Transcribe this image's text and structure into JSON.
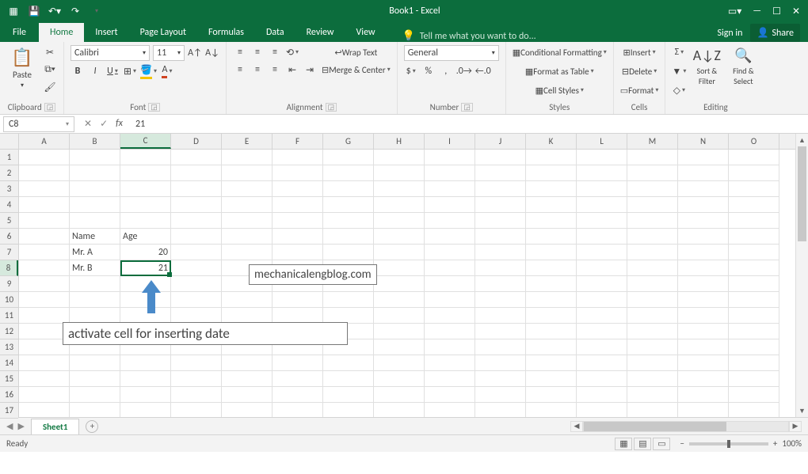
{
  "titlebar": {
    "title": "Book1 - Excel"
  },
  "tabs": {
    "file": "File",
    "list": [
      "Home",
      "Insert",
      "Page Layout",
      "Formulas",
      "Data",
      "Review",
      "View"
    ],
    "active": "Home",
    "tell_me": "Tell me what you want to do...",
    "sign_in": "Sign in",
    "share": "Share"
  },
  "ribbon": {
    "clipboard": {
      "paste": "Paste",
      "label": "Clipboard"
    },
    "font": {
      "name": "Calibri",
      "size": "11",
      "bold": "B",
      "italic": "I",
      "underline": "U",
      "label": "Font"
    },
    "alignment": {
      "wrap": "Wrap Text",
      "merge": "Merge & Center",
      "label": "Alignment"
    },
    "number": {
      "format": "General",
      "label": "Number"
    },
    "styles": {
      "cond": "Conditional Formatting",
      "table": "Format as Table",
      "cell": "Cell Styles",
      "label": "Styles"
    },
    "cells": {
      "insert": "Insert",
      "delete": "Delete",
      "format": "Format",
      "label": "Cells"
    },
    "editing": {
      "sort": "Sort & Filter",
      "find": "Find & Select",
      "label": "Editing"
    }
  },
  "formula_bar": {
    "name_box": "C8",
    "formula": "21"
  },
  "grid": {
    "columns": [
      "A",
      "B",
      "C",
      "D",
      "E",
      "F",
      "G",
      "H",
      "I",
      "J",
      "K",
      "L",
      "M",
      "N",
      "O"
    ],
    "selected_col": "C",
    "selected_row": 8,
    "data": {
      "B6": "Name",
      "C6": "Age",
      "B7": "Mr. A",
      "C7": "20",
      "B8": "Mr. B",
      "C8": "21"
    }
  },
  "annotations": {
    "text1": "mechanicalengblog.com",
    "text2": "activate cell for inserting date"
  },
  "sheets": {
    "active": "Sheet1"
  },
  "status": {
    "ready": "Ready",
    "zoom": "100%"
  },
  "chart_data": {
    "type": "table",
    "columns": [
      "Name",
      "Age"
    ],
    "rows": [
      [
        "Mr. A",
        20
      ],
      [
        "Mr. B",
        21
      ]
    ]
  }
}
